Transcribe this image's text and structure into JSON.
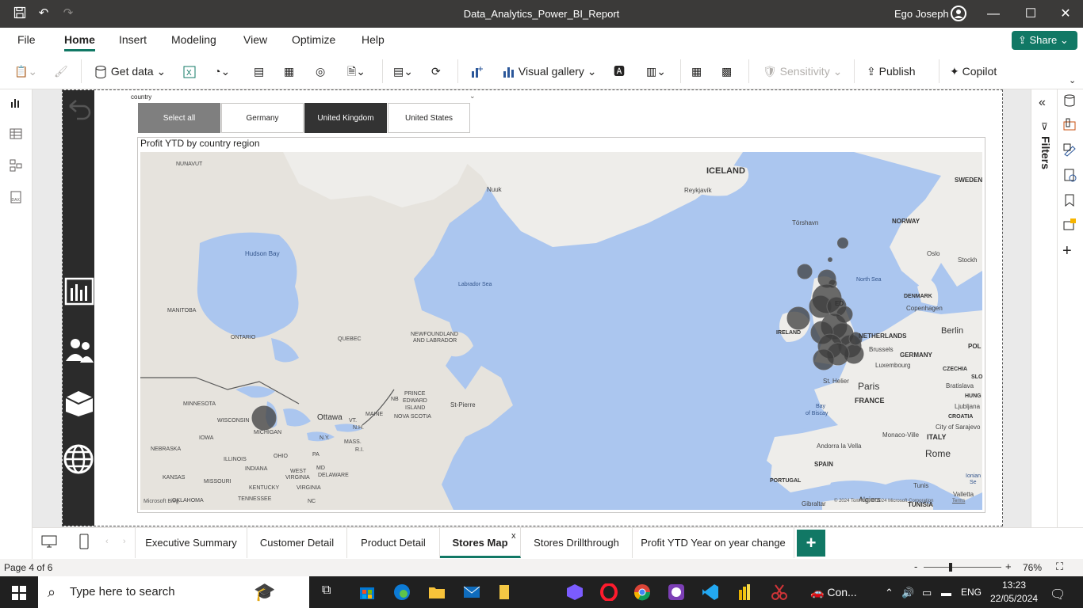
{
  "titlebar": {
    "title": "Data_Analytics_Power_BI_Report",
    "user": "Ego Joseph"
  },
  "menu": {
    "items": [
      "File",
      "Home",
      "Insert",
      "Modeling",
      "View",
      "Optimize",
      "Help"
    ],
    "share": "Share"
  },
  "ribbon": {
    "get_data": "Get data",
    "visual_gallery": "Visual gallery",
    "sensitivity": "Sensitivity",
    "publish": "Publish",
    "copilot": "Copilot"
  },
  "slicer": {
    "label": "country",
    "options": [
      "Select all",
      "Germany",
      "United Kingdom",
      "United States"
    ],
    "selected": "United Kingdom"
  },
  "visual": {
    "title": "Profit YTD by country region"
  },
  "map_labels": {
    "nunavut": "NUNAVUT",
    "hudson_bay": "Hudson Bay",
    "nuuk": "Nuuk",
    "iceland": "ICELAND",
    "reykjavik": "Reykjavík",
    "torshavn": "Tórshavn",
    "norway": "NORWAY",
    "sweden": "SWEDEN",
    "oslo": "Oslo",
    "stockholm": "Stockh",
    "north_sea": "North Sea",
    "denmark": "DENMARK",
    "copenhagen": "Copenhagen",
    "berlin": "Berlin",
    "pol": "POL",
    "labrador_sea": "Labrador Sea",
    "manitoba": "MANITOBA",
    "ontario": "ONTARIO",
    "quebec": "QUEBEC",
    "newfoundland": "NEWFOUNDLAND",
    "and_labrador": "AND LABRADOR",
    "ireland": "IRELAND",
    "united_kingdom_partial": "ED",
    "netherlands": "NETHERLANDS",
    "brussels": "Brussels",
    "luxembourg": "Luxembourg",
    "germany": "GERMANY",
    "czechia": "CZECHIA",
    "paris": "Paris",
    "st_helier": "St. Helier",
    "france": "FRANCE",
    "bay_of_biscay": "Bay",
    "of_biscay": "of Biscay",
    "minnesota": "MINNESOTA",
    "wisconsin": "WISCONSIN",
    "michigan": "MICHIGAN",
    "ottawa": "Ottawa",
    "maine": "MAINE",
    "nb": "NB",
    "pei": "PRINCE",
    "edward": "EDWARD",
    "island": "ISLAND",
    "nova_scotia": "NOVA SCOTIA",
    "st_pierre": "St-Pierre",
    "iowa": "IOWA",
    "nebraska": "NEBRASKA",
    "illinois": "ILLINOIS",
    "ohio": "OHIO",
    "pa": "PA",
    "ny": "N.Y.",
    "vt": "VT.",
    "nh": "N.H.",
    "mass": "MASS.",
    "ri": "R.I.",
    "kansas": "KANSAS",
    "missouri": "MISSOURI",
    "indiana": "INDIANA",
    "west": "WEST",
    "virginia_w": "VIRGINIA",
    "md": "MD",
    "delaware": "DELAWARE",
    "kentucky": "KENTUCKY",
    "virginia": "VIRGINIA",
    "oklahoma": "OKLAHOMA",
    "tennessee": "TENNESSEE",
    "nc": "NC",
    "bratislava": "Bratislava",
    "slo": "SLO",
    "hung": "HUNG",
    "ljubljana": "Ljubljana",
    "croatia": "CROATIA",
    "sarajevo": "City of Sarajevo",
    "monaco": "Monaco-Ville",
    "italy": "ITALY",
    "andorra": "Andorra la Vella",
    "spain": "SPAIN",
    "rome": "Rome",
    "portugal": "PORTUGAL",
    "tunis": "Tunis",
    "valletta": "Valletta",
    "tunisia": "TUNISIA",
    "gibraltar": "Gibraltar",
    "algiers": "Algiers",
    "ionian": "Ionian",
    "sea": "Se"
  },
  "map_footer": {
    "logo": "Microsoft Bing",
    "copyright": "© 2024 TomTom, © 2024 Microsoft Corporation",
    "terms": "Terms"
  },
  "filters_label": "Filters",
  "tabs": [
    "Executive Summary",
    "Customer Detail",
    "Product Detail",
    "Stores Map",
    "Stores Drillthrough",
    "Profit YTD Year on year change"
  ],
  "active_tab": "Stores Map",
  "status": {
    "page": "Page 4 of 6",
    "zoom": "76%"
  },
  "taskbar": {
    "search_placeholder": "Type here to search",
    "app_label": "Con...",
    "lang": "ENG",
    "time": "13:23",
    "date": "22/05/2024"
  }
}
